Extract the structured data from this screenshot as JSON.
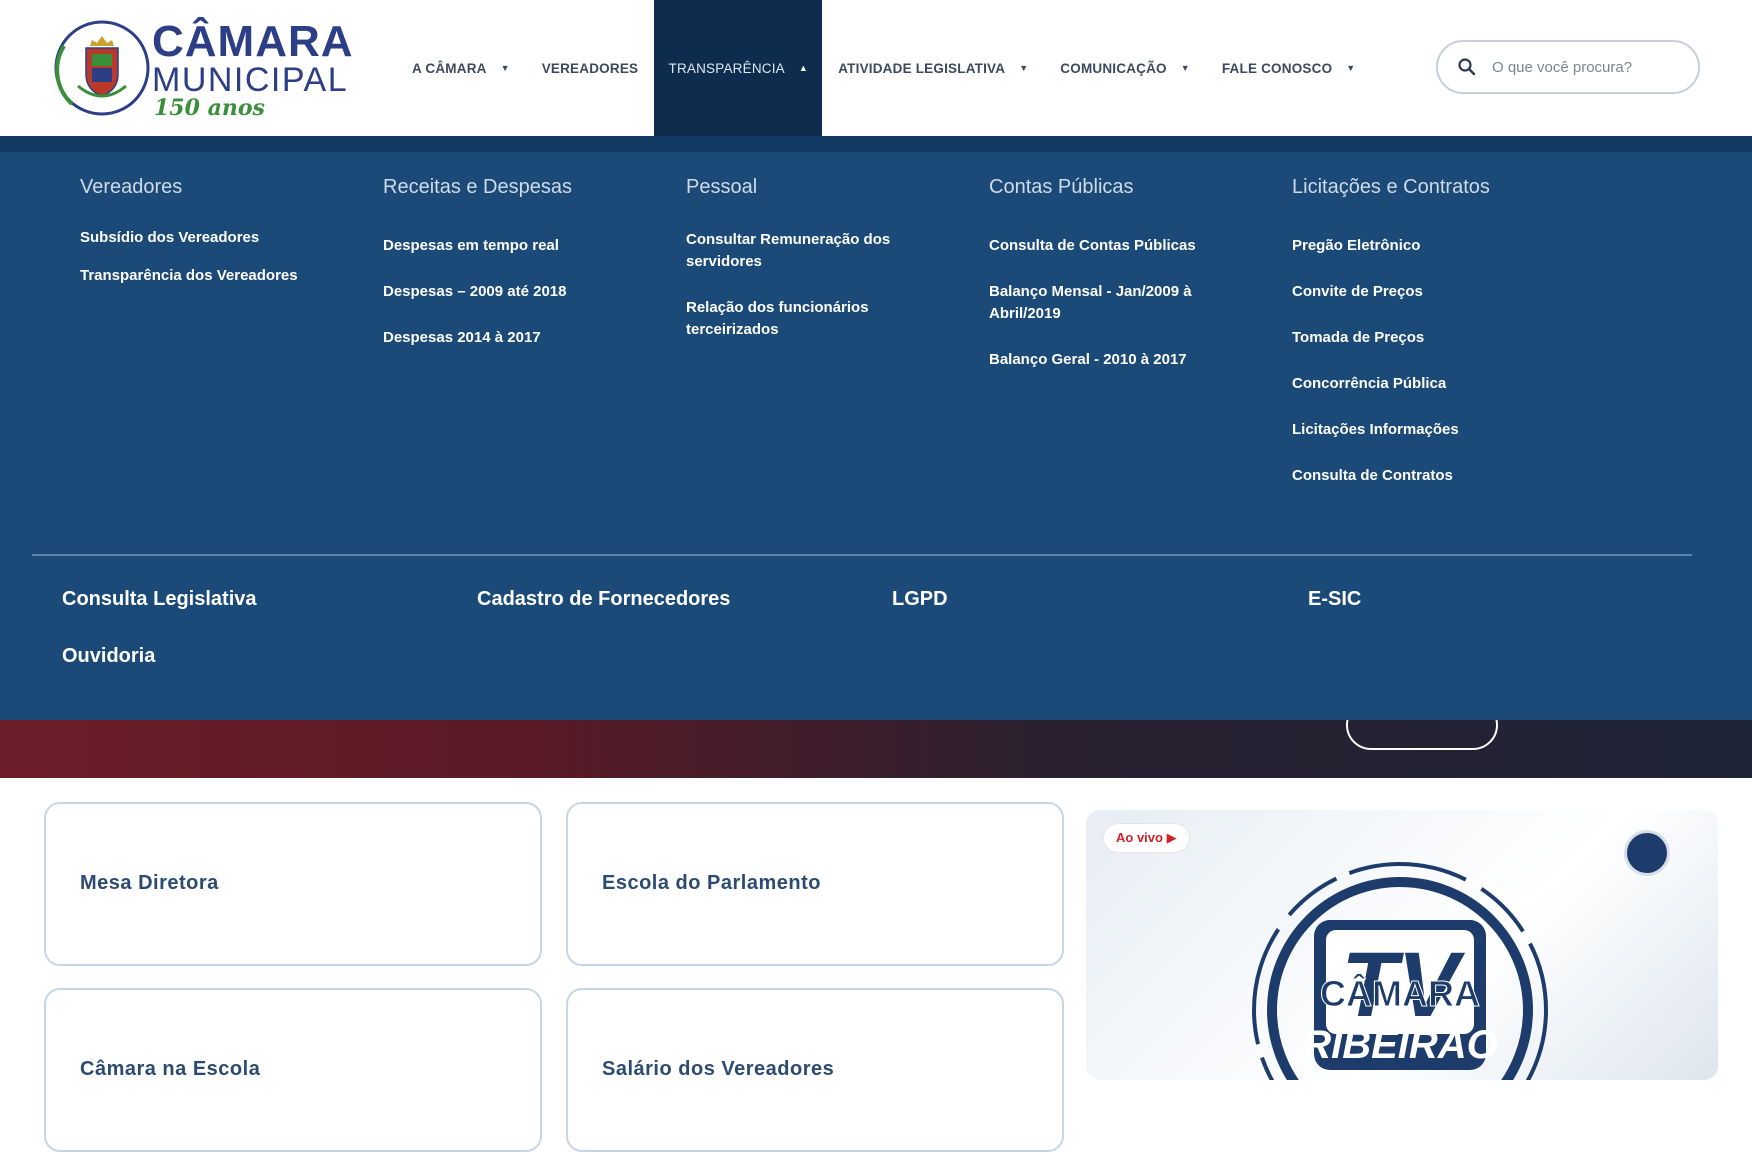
{
  "header": {
    "logo": {
      "line1": "CÂMARA",
      "line2": "MUNICIPAL",
      "line3": "150 anos"
    },
    "nav": [
      {
        "label": "A CÂMARA",
        "has_caret": true
      },
      {
        "label": "VEREADORES",
        "has_caret": false
      },
      {
        "label": "TRANSPARÊNCIA",
        "has_caret": true,
        "active": true
      },
      {
        "label": "ATIVIDADE LEGISLATIVA",
        "has_caret": true
      },
      {
        "label": "COMUNICAÇÃO",
        "has_caret": true
      },
      {
        "label": "FALE CONOSCO",
        "has_caret": true
      }
    ],
    "search": {
      "placeholder": "O que você procura?",
      "icon": "search-icon"
    }
  },
  "mega_menu": {
    "columns": [
      {
        "title": "Vereadores",
        "links": [
          "Subsídio dos Vereadores",
          "Transparência dos Vereadores"
        ]
      },
      {
        "title": "Receitas e Despesas",
        "links": [
          "Despesas em tempo real",
          "Despesas – 2009 até 2018",
          "Despesas 2014 à 2017"
        ]
      },
      {
        "title": "Pessoal",
        "links": [
          "Consultar Remuneração dos servidores",
          "Relação dos funcionários terceirizados"
        ]
      },
      {
        "title": "Contas Públicas",
        "links": [
          "Consulta de Contas Públicas",
          "Balanço Mensal - Jan/2009 à Abril/2019",
          "Balanço Geral - 2010 à 2017"
        ]
      },
      {
        "title": "Licitações e Contratos",
        "links": [
          "Pregão Eletrônico",
          "Convite de Preços",
          "Tomada de Preços",
          "Concorrência Pública",
          "Licitações Informações",
          "Consulta de Contratos"
        ]
      }
    ],
    "bottom_links": [
      "Consulta Legislativa",
      "Cadastro de Fornecedores",
      "LGPD",
      "E-SIC",
      "Ouvidoria"
    ]
  },
  "cards": [
    "Mesa Diretora",
    "Escola do Parlamento",
    "Câmara na Escola",
    "Salário dos Vereadores"
  ],
  "tv": {
    "live_badge": "Ao vivo ▶",
    "logo_line1": "TV",
    "logo_line2": "CÂMARA",
    "logo_line3": "RIBEIRÃO"
  },
  "colors": {
    "brand_blue": "#2c3e86",
    "brand_green": "#3a8f3a",
    "nav_active_bg": "#0e2d4e",
    "mega_bg": "#1b4a78",
    "live_red": "#d0202a"
  }
}
